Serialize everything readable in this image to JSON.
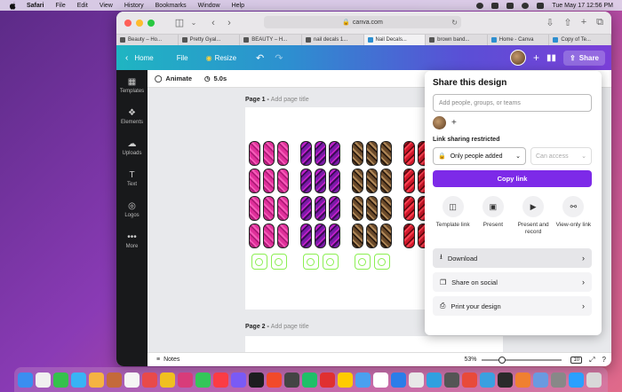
{
  "menubar": {
    "items": [
      "Safari",
      "File",
      "Edit",
      "View",
      "History",
      "Bookmarks",
      "Window",
      "Help"
    ],
    "clock": "Tue May 17  12:56 PM"
  },
  "browser": {
    "url": "canva.com",
    "tabs": [
      "Beauty – Ho...",
      "Pretty Gyal...",
      "BEAUTY – H...",
      "nail decals 1...",
      "Nail Decals...",
      "brown band...",
      "Home - Canva",
      "Copy of Te..."
    ],
    "active_tab": 4
  },
  "canva_header": {
    "home": "Home",
    "file": "File",
    "resize": "Resize",
    "share": "Share"
  },
  "sidebar": [
    {
      "label": "Templates",
      "icon": "templates-icon",
      "glyph": "▦"
    },
    {
      "label": "Elements",
      "icon": "elements-icon",
      "glyph": "❖"
    },
    {
      "label": "Uploads",
      "icon": "uploads-icon",
      "glyph": "☁"
    },
    {
      "label": "Text",
      "icon": "text-icon",
      "glyph": "T"
    },
    {
      "label": "Logos",
      "icon": "logos-icon",
      "glyph": "◎"
    },
    {
      "label": "More",
      "icon": "more-icon",
      "glyph": "•••"
    }
  ],
  "editbar": {
    "animate": "Animate",
    "duration": "5.0s"
  },
  "pages": [
    {
      "label": "Page 1 - ",
      "placeholder": "Add page title"
    },
    {
      "label": "Page 2 - ",
      "placeholder": "Add page title"
    }
  ],
  "bottombar": {
    "notes": "Notes",
    "zoom": "53%",
    "zoom_fraction": 0.25,
    "page_count": "10"
  },
  "share": {
    "title": "Share this design",
    "input_placeholder": "Add people, groups, or teams",
    "link_label": "Link sharing restricted",
    "access_select": "Only people added",
    "permission_select": "Can access",
    "copy_button": "Copy link",
    "options": [
      {
        "label": "Template link",
        "icon": "template-link-icon",
        "glyph": "◫"
      },
      {
        "label": "Present",
        "icon": "present-icon",
        "glyph": "▣"
      },
      {
        "label": "Present and record",
        "icon": "present-record-icon",
        "glyph": "▶"
      },
      {
        "label": "View-only link",
        "icon": "view-only-link-icon",
        "glyph": "⚯"
      }
    ],
    "rows": [
      {
        "label": "Download",
        "icon": "download-icon",
        "glyph": "⭳"
      },
      {
        "label": "Share on social",
        "icon": "social-icon",
        "glyph": "❐"
      },
      {
        "label": "Print your design",
        "icon": "print-icon",
        "glyph": "⎙"
      }
    ]
  },
  "colors": {
    "accent": "#7d2ae8",
    "neon_green": "#8bef52"
  }
}
